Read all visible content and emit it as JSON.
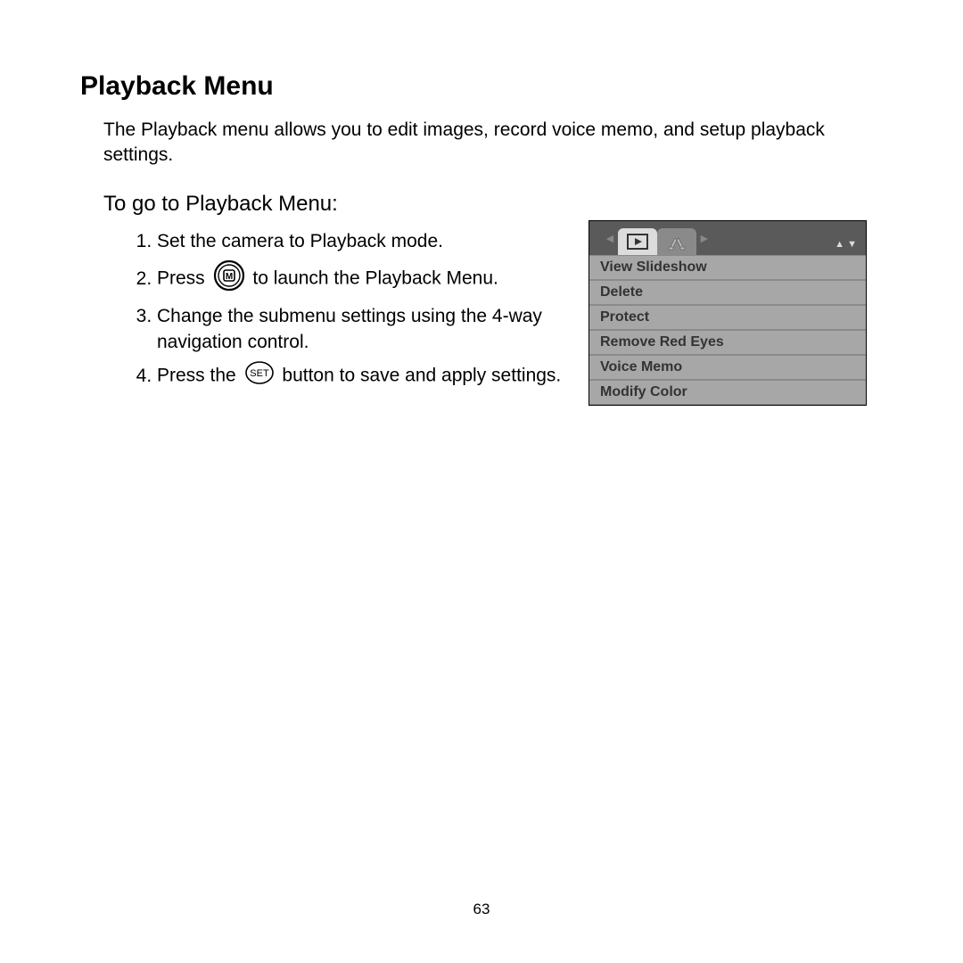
{
  "title": "Playback Menu",
  "intro": "The Playback menu allows you to edit images, record voice memo, and setup playback settings.",
  "subhead": "To go to Playback Menu:",
  "steps": {
    "s1": "Set the camera to Playback mode.",
    "s2a": "Press ",
    "s2b": " to launch the Playback Menu.",
    "s3": "Change the submenu settings using the 4-way navigation control.",
    "s4a": "Press the ",
    "s4b": " button to save and apply settings."
  },
  "menu": {
    "items": [
      {
        "label": "View Slideshow"
      },
      {
        "label": "Delete"
      },
      {
        "label": "Protect"
      },
      {
        "label": "Remove Red Eyes"
      },
      {
        "label": "Voice Memo"
      },
      {
        "label": "Modify Color"
      }
    ]
  },
  "page_number": "63"
}
